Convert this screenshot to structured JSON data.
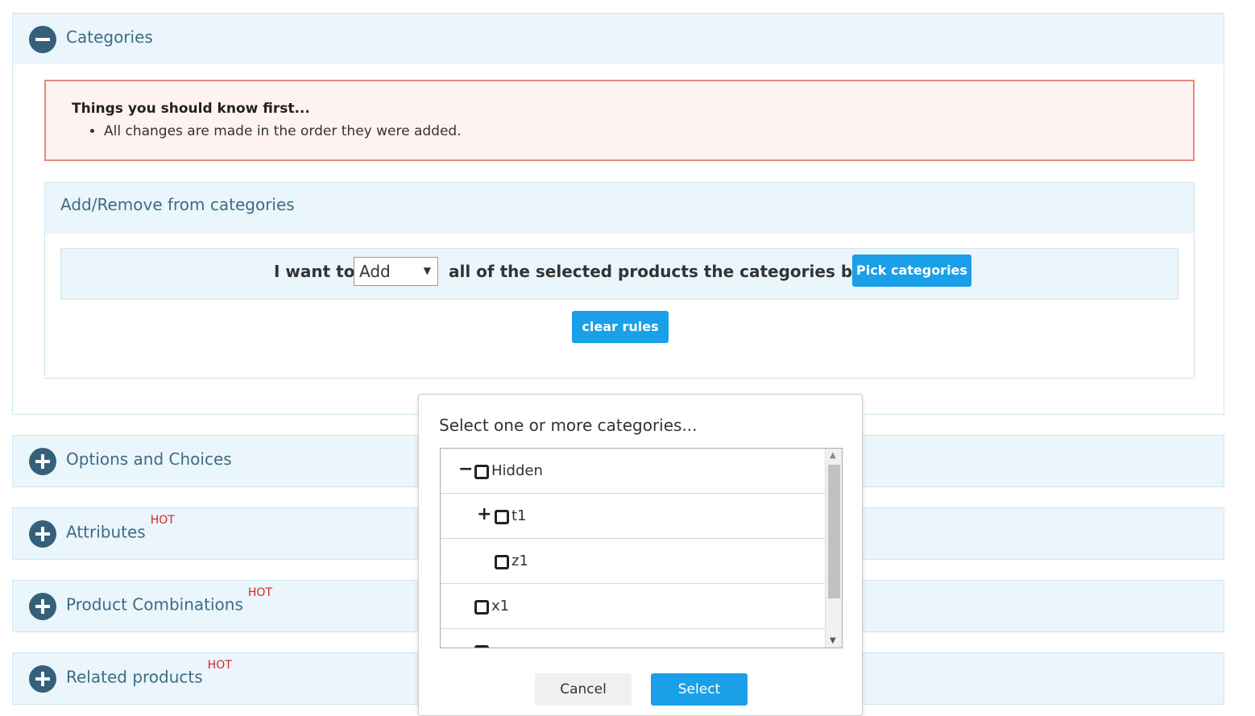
{
  "categories_panel": {
    "title": "Categories",
    "notice": {
      "title": "Things you should know first...",
      "items": [
        "All changes are made in the order they were added."
      ]
    },
    "subpanel": {
      "title": "Add/Remove from categories",
      "rule": {
        "prefix": "I want to",
        "action_value": "Add",
        "suffix": "all of the selected products the categories below",
        "pick_label": "Pick categories"
      },
      "clear_label": "clear rules"
    }
  },
  "panels": [
    {
      "title": "Options and Choices",
      "badge": ""
    },
    {
      "title": "Attributes",
      "badge": "HOT"
    },
    {
      "title": "Product Combinations",
      "badge": "HOT"
    },
    {
      "title": "Related products",
      "badge": "HOT"
    }
  ],
  "dialog": {
    "title": "Select one or more categories...",
    "tree": [
      {
        "label": "Hidden",
        "expander": "minus"
      },
      {
        "label": "t1",
        "expander": "plus"
      },
      {
        "label": "z1",
        "expander": ""
      },
      {
        "label": "x1",
        "expander": ""
      }
    ],
    "cancel_label": "Cancel",
    "select_label": "Select"
  },
  "colors": {
    "panel_bg": "#eaf6fc",
    "toggle": "#35607a",
    "button_blue": "#1aa0e8",
    "notice_border": "#e8897a",
    "hot": "#e02020"
  }
}
